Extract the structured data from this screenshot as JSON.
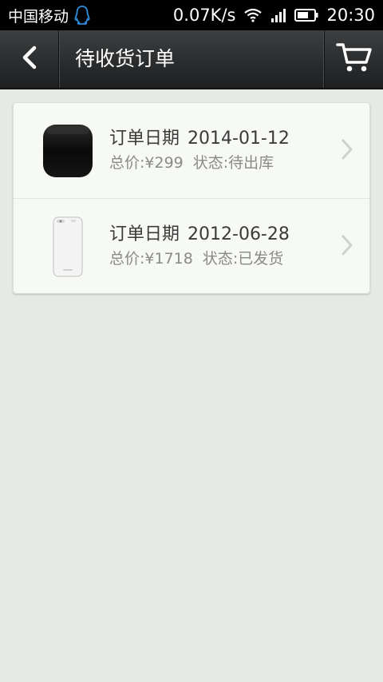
{
  "status_bar": {
    "carrier": "中国移动",
    "net_speed": "0.07K/s",
    "time": "20:30",
    "icons": [
      "qq-icon",
      "wifi-icon",
      "signal-icon",
      "battery-icon"
    ]
  },
  "header": {
    "title": "待收货订单",
    "back_icon": "back-arrow-icon",
    "cart_icon": "cart-icon"
  },
  "orders": [
    {
      "date_label": "订单日期",
      "date": "2014-01-12",
      "total": "总价:¥299",
      "status": "状态:待出库",
      "thumb": "router-icon"
    },
    {
      "date_label": "订单日期",
      "date": "2012-06-28",
      "total": "总价:¥1718",
      "status": "状态:已发货",
      "thumb": "phone-icon"
    }
  ],
  "colors": {
    "page_bg": "#e7e9e5",
    "header_bg": "#2a2c2e",
    "card_bg": "#f7f9f5",
    "text_primary": "#3a3a3a",
    "text_secondary": "#8a8a8a"
  }
}
